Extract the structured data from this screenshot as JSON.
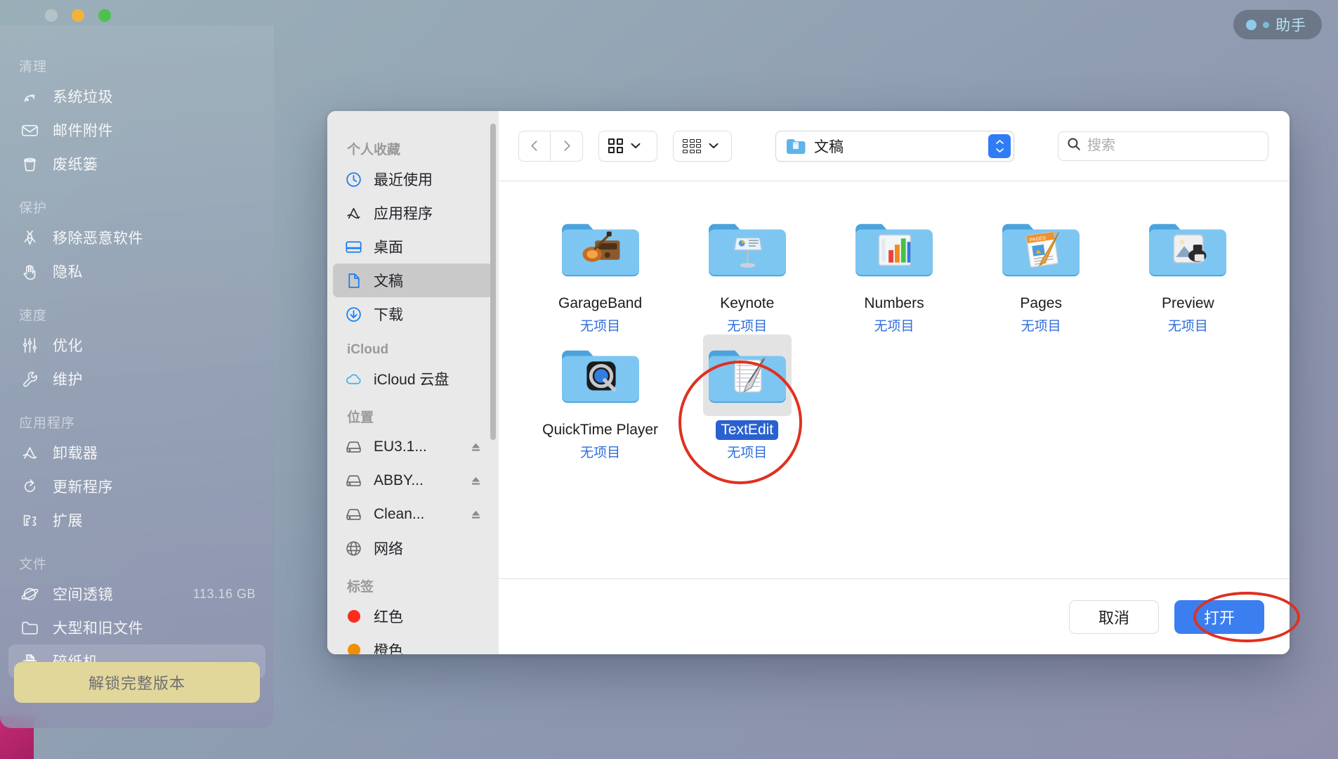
{
  "window": {
    "traffic_lights": [
      "close",
      "minimize",
      "maximize"
    ],
    "assistant_label": "助手"
  },
  "cmm_sidebar": {
    "groups": [
      {
        "title": "清理",
        "items": [
          {
            "label": "系统垃圾",
            "icon": "broom-icon",
            "value": ""
          },
          {
            "label": "邮件附件",
            "icon": "mail-icon",
            "value": ""
          },
          {
            "label": "废纸篓",
            "icon": "trash-icon",
            "value": ""
          }
        ]
      },
      {
        "title": "保护",
        "items": [
          {
            "label": "移除恶意软件",
            "icon": "biohazard-icon",
            "value": ""
          },
          {
            "label": "隐私",
            "icon": "hand-icon",
            "value": ""
          }
        ]
      },
      {
        "title": "速度",
        "items": [
          {
            "label": "优化",
            "icon": "sliders-icon",
            "value": ""
          },
          {
            "label": "维护",
            "icon": "wrench-icon",
            "value": ""
          }
        ]
      },
      {
        "title": "应用程序",
        "items": [
          {
            "label": "卸载器",
            "icon": "appstore-icon",
            "value": ""
          },
          {
            "label": "更新程序",
            "icon": "refresh-icon",
            "value": ""
          },
          {
            "label": "扩展",
            "icon": "puzzle-icon",
            "value": ""
          }
        ]
      },
      {
        "title": "文件",
        "items": [
          {
            "label": "空间透镜",
            "icon": "planet-icon",
            "value": "113.16 GB"
          },
          {
            "label": "大型和旧文件",
            "icon": "folder-icon",
            "value": ""
          },
          {
            "label": "碎纸机",
            "icon": "shredder-icon",
            "value": "",
            "selected": true
          }
        ]
      }
    ],
    "unlock_button": "解锁完整版本"
  },
  "finder": {
    "sidebar": {
      "groups": [
        {
          "title": "个人收藏",
          "items": [
            {
              "label": "最近使用",
              "icon": "clock-icon"
            },
            {
              "label": "应用程序",
              "icon": "appstore-icon"
            },
            {
              "label": "桌面",
              "icon": "desktop-icon"
            },
            {
              "label": "文稿",
              "icon": "document-icon",
              "selected": true
            },
            {
              "label": "下载",
              "icon": "download-icon"
            }
          ]
        },
        {
          "title": "iCloud",
          "items": [
            {
              "label": "iCloud 云盘",
              "icon": "cloud-icon"
            }
          ]
        },
        {
          "title": "位置",
          "items": [
            {
              "label": "EU3.1...",
              "icon": "drive-icon",
              "eject": true
            },
            {
              "label": "ABBY...",
              "icon": "drive-icon",
              "eject": true
            },
            {
              "label": "Clean...",
              "icon": "drive-icon",
              "eject": true
            },
            {
              "label": "网络",
              "icon": "globe-icon"
            }
          ]
        },
        {
          "title": "标签",
          "items": [
            {
              "label": "红色",
              "icon": "tag-dot-icon",
              "color": "#fb2c1e"
            },
            {
              "label": "橙色",
              "icon": "tag-dot-icon",
              "color": "#f09000"
            }
          ]
        }
      ]
    },
    "toolbar": {
      "back_label": "后退",
      "forward_label": "前进",
      "view_icon_label": "图标视图",
      "arrange_label": "排列方式",
      "path_label": "文稿",
      "search_placeholder": "搜索",
      "search_value": ""
    },
    "files": [
      {
        "name": "GarageBand",
        "sub": "无项目",
        "icon": "garageband-folder-icon"
      },
      {
        "name": "Keynote",
        "sub": "无项目",
        "icon": "keynote-folder-icon"
      },
      {
        "name": "Numbers",
        "sub": "无项目",
        "icon": "numbers-folder-icon"
      },
      {
        "name": "Pages",
        "sub": "无项目",
        "icon": "pages-folder-icon"
      },
      {
        "name": "Preview",
        "sub": "无项目",
        "icon": "preview-folder-icon"
      },
      {
        "name": "QuickTime Player",
        "sub": "无项目",
        "icon": "quicktime-folder-icon"
      },
      {
        "name": "TextEdit",
        "sub": "无项目",
        "icon": "textedit-folder-icon",
        "selected": true
      }
    ],
    "footer": {
      "cancel_label": "取消",
      "open_label": "打开"
    }
  },
  "colors": {
    "accent_blue": "#3b7ef0",
    "selection_blue": "#2a61d0",
    "annotation_red": "#e03020",
    "unlock_gold": "#e2d79b",
    "sub_text_blue": "#2f6ddc"
  }
}
